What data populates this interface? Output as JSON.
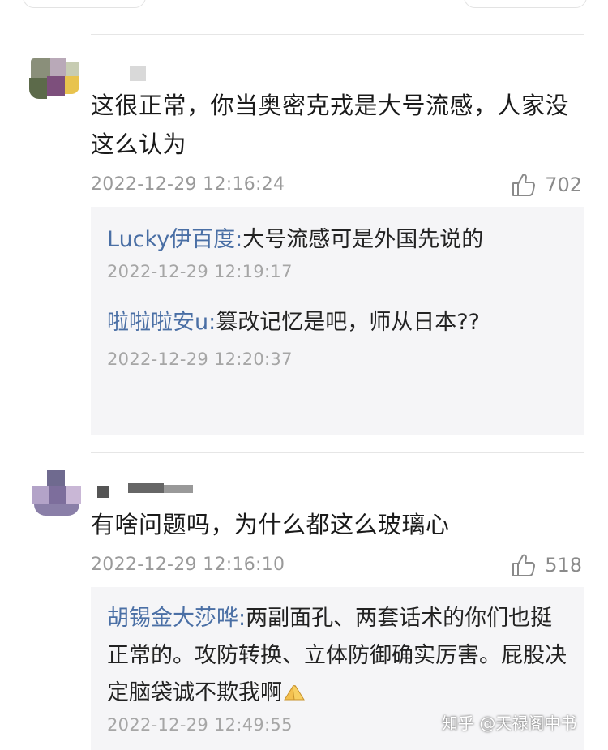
{
  "comments": [
    {
      "text": "这很正常，你当奥密克戎是大号流感，人家没这么认为",
      "time": "2022-12-29 12:16:24",
      "likes": "702",
      "replies": [
        {
          "name": "Lucky伊百度:",
          "text": "大号流感可是外国先说的",
          "time": "2022-12-29 12:19:17"
        },
        {
          "name": "啦啦啦安u:",
          "text": "篡改记忆是吧，师从日本??",
          "time": "2022-12-29 12:20:37"
        }
      ]
    },
    {
      "text": "有啥问题吗，为什么都这么玻璃心",
      "time": "2022-12-29 12:16:10",
      "likes": "518",
      "replies": [
        {
          "name": "胡锡金大莎哗:",
          "text": "两副面孔、两套话术的你们也挺正常的。攻防转换、立体防御确实厉害。屁股决定脑袋诚不欺我啊",
          "emoji": "praying-hands-icon",
          "time": "2022-12-29 12:49:55"
        }
      ]
    }
  ],
  "watermark": "知乎 @天禄阁中书"
}
